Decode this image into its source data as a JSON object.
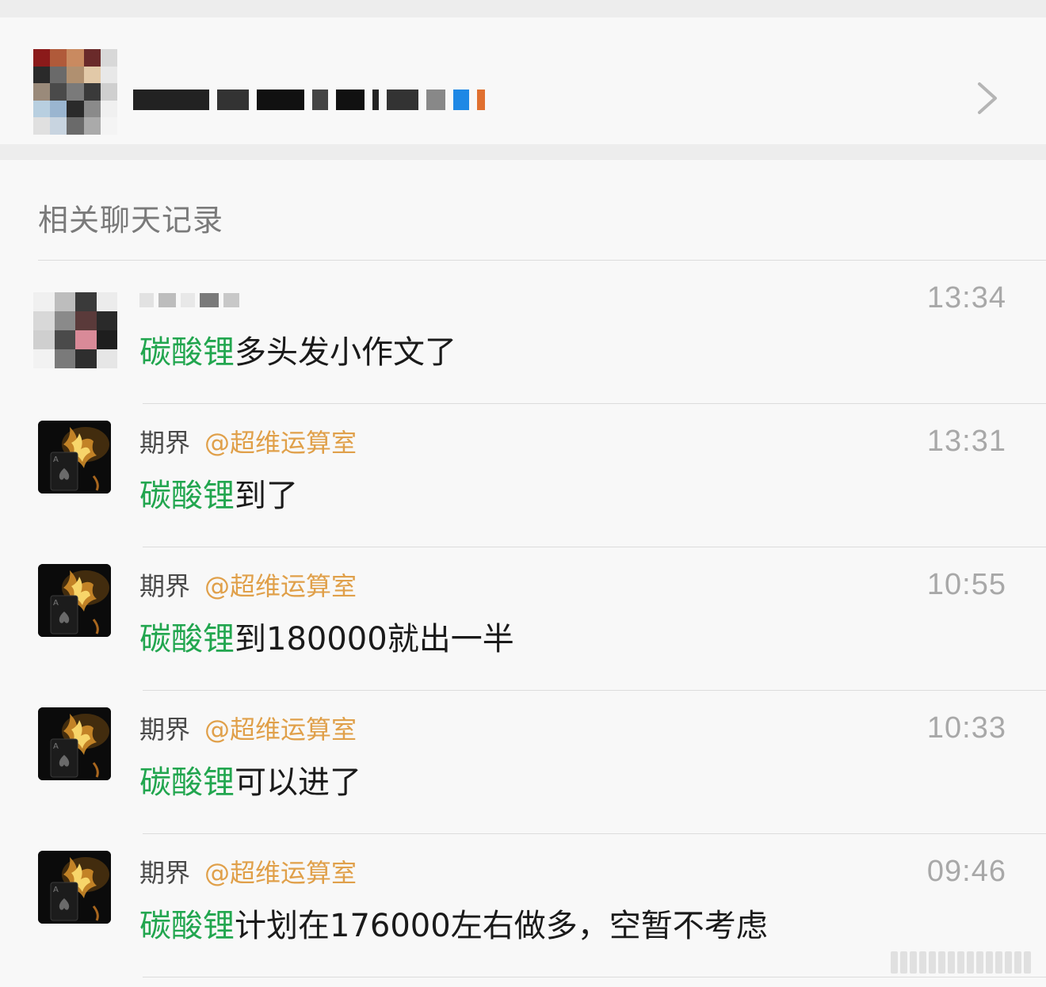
{
  "group": {
    "avatar_icon": "group-avatar-pixelated",
    "name_icon": "redacted-group-name",
    "chevron_icon": "chevron-right-icon"
  },
  "section": {
    "title": "相关聊天记录"
  },
  "records": [
    {
      "sender": "",
      "mention": "",
      "keyword": "碳酸锂",
      "text": "多头发小作文了",
      "time": "13:34",
      "avatar_icon": "pixelated-avatar"
    },
    {
      "sender": "期界",
      "mention": "@超维运算室",
      "keyword": "碳酸锂",
      "text": "到了",
      "time": "13:31",
      "avatar_icon": "ace-of-spades-avatar"
    },
    {
      "sender": "期界",
      "mention": "@超维运算室",
      "keyword": "碳酸锂",
      "text": "到180000就出一半",
      "time": "10:55",
      "avatar_icon": "ace-of-spades-avatar"
    },
    {
      "sender": "期界",
      "mention": "@超维运算室",
      "keyword": "碳酸锂",
      "text": "可以进了",
      "time": "10:33",
      "avatar_icon": "ace-of-spades-avatar"
    },
    {
      "sender": "期界",
      "mention": "@超维运算室",
      "keyword": "碳酸锂",
      "text": "计划在176000左右做多，空暂不考虑",
      "time": "09:46",
      "avatar_icon": "ace-of-spades-avatar"
    }
  ],
  "colors": {
    "keyword": "#22a64f",
    "mention": "#e0a04a",
    "time": "#a8a8a8",
    "background": "#ededed",
    "card": "#f8f8f8"
  }
}
